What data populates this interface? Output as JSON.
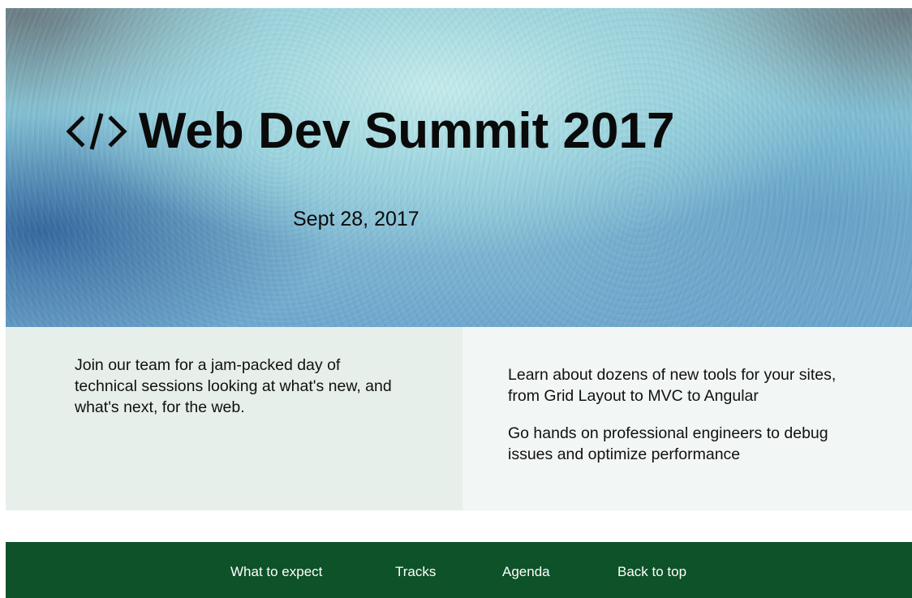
{
  "hero": {
    "title": "Web Dev Summit 2017",
    "date": "Sept 28, 2017",
    "icon": "code-icon"
  },
  "intro": {
    "left_text": "Join our team for a jam-packed day of technical sessions looking at what's new, and what's next, for the web.",
    "right_paragraphs": [
      "Learn about dozens of new tools for your sites, from Grid Layout to MVC to Angular",
      "Go hands on professional engineers to debug issues and optimize performance"
    ]
  },
  "nav": {
    "items": [
      {
        "label": "What to expect"
      },
      {
        "label": "Tracks"
      },
      {
        "label": "Agenda"
      },
      {
        "label": "Back to top"
      }
    ]
  },
  "colors": {
    "nav_background": "#0d5228",
    "left_panel": "#e6efe9",
    "right_panel": "#f2f6f5",
    "nav_text": "#ffffff"
  }
}
